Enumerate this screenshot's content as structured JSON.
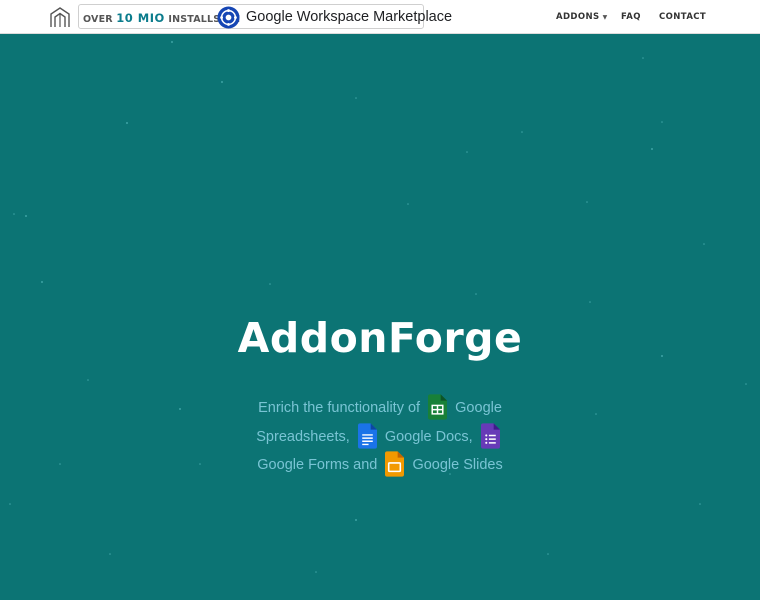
{
  "navbar": {
    "badge": {
      "prefix": "OVER",
      "count": "10 MIO",
      "suffix": "INSTALLS ON",
      "marketplace": "Google Workspace Marketplace"
    },
    "links": {
      "addons": "ADDONS",
      "faq": "FAQ",
      "contact": "CONTACT"
    }
  },
  "hero": {
    "title": "AddonForge",
    "subtitle": {
      "part1": "Enrich the functionality of",
      "sheets": "Google Spreadsheets,",
      "docs": "Google Docs,",
      "forms": "Google Forms and",
      "slides": "Google Slides"
    }
  },
  "icons": {
    "logo": "building-outline-icon",
    "marketplace": "google-workspace-marketplace-icon",
    "sheets": "google-sheets-icon",
    "docs": "google-docs-icon",
    "forms": "google-forms-icon",
    "slides": "google-slides-icon"
  },
  "colors": {
    "hero_background": "#0c7474",
    "subtitle_text": "#79c4d4",
    "badge_accent": "#0b7c8c",
    "sheets": "#188038",
    "docs": "#1a73e8",
    "forms": "#673ab7",
    "slides": "#f29900"
  }
}
